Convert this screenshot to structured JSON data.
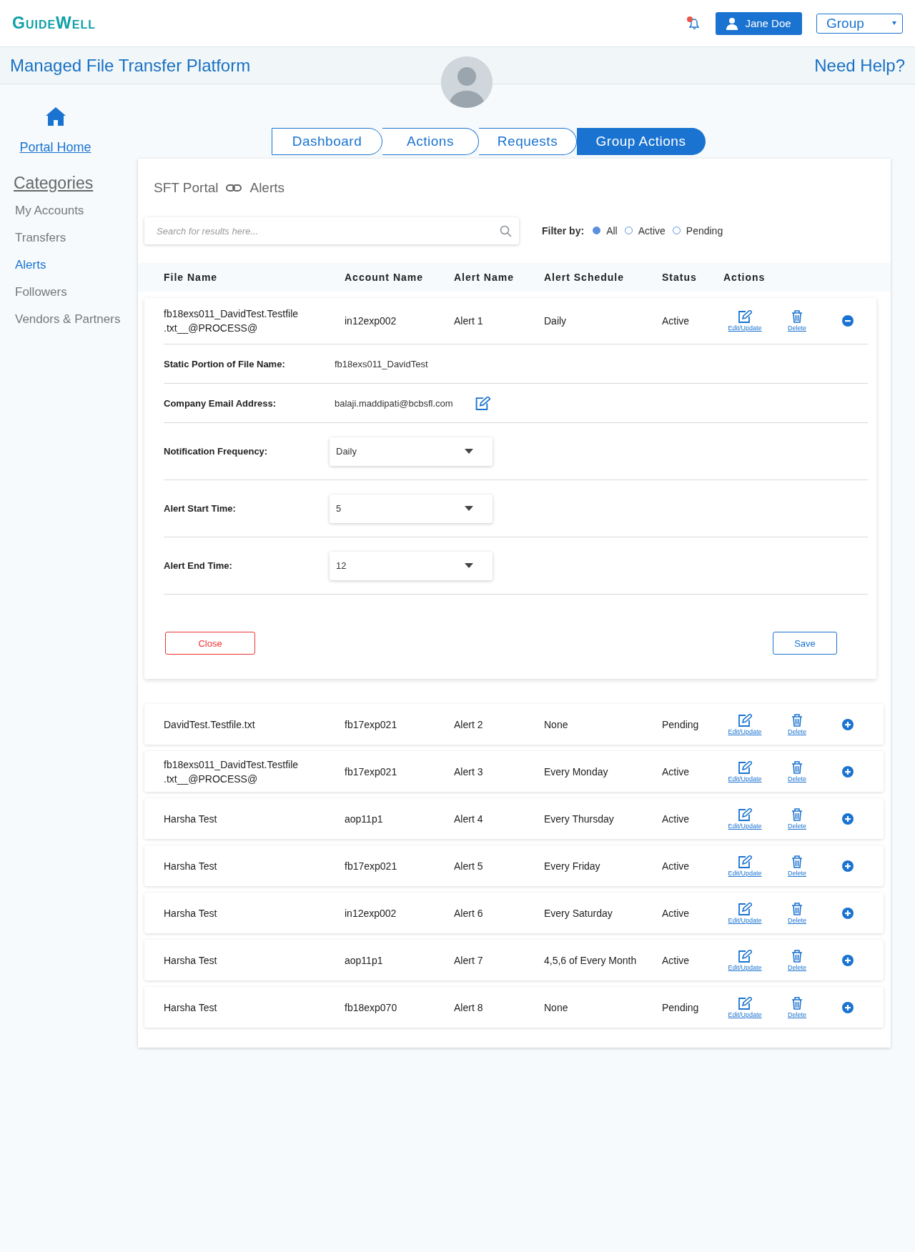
{
  "header": {
    "logo": "GuideWell",
    "user_button": "Jane Doe",
    "group_select": "Group"
  },
  "title_bar": {
    "title": "Managed File Transfer Platform",
    "help_link": "Need Help?"
  },
  "nav_tabs": [
    {
      "label": "Dashboard",
      "selected": false
    },
    {
      "label": "Actions",
      "selected": false
    },
    {
      "label": "Requests",
      "selected": false
    },
    {
      "label": "Group Actions",
      "selected": true
    }
  ],
  "sidebar": {
    "home_link": "Portal Home",
    "heading": "Categories",
    "items": [
      {
        "label": "My Accounts",
        "selected": false
      },
      {
        "label": "Transfers",
        "selected": false
      },
      {
        "label": "Alerts",
        "selected": true
      },
      {
        "label": "Followers",
        "selected": false
      },
      {
        "label": "Vendors & Partners",
        "selected": false
      }
    ]
  },
  "breadcrumb": [
    "SFT Portal",
    "Alerts"
  ],
  "search": {
    "placeholder": "Search for results here..."
  },
  "filter": {
    "label": "Filter by:",
    "options": [
      {
        "label": "All",
        "selected": true
      },
      {
        "label": "Active",
        "selected": false
      },
      {
        "label": "Pending",
        "selected": false
      }
    ]
  },
  "table": {
    "columns": [
      "File Name",
      "Account Name",
      "Alert Name",
      "Alert Schedule",
      "Status",
      "Actions"
    ],
    "rows": [
      {
        "file_name": "fb18exs011_DavidTest.Testfile\n.txt__@PROCESS@",
        "account_name": "in12exp002",
        "alert_name": "Alert 1",
        "schedule": "Daily",
        "status": "Active",
        "edit": "Edit/Update",
        "delete": "Delete",
        "expanded": true,
        "details": {
          "static_label": "Static Portion of File Name:",
          "static_value": "fb18exs011_DavidTest",
          "email_label": "Company Email Address:",
          "email_value": "balaji.maddipati@bcbsfl.com",
          "fields": [
            {
              "label": "Notification Frequency:",
              "value": "Daily"
            },
            {
              "label": "Alert Start Time:",
              "value": "5"
            },
            {
              "label": "Alert End Time:",
              "value": "12"
            }
          ],
          "close_button": "Close",
          "save_button": "Save"
        }
      },
      {
        "file_name": "DavidTest.Testfile.txt",
        "account_name": "fb17exp021",
        "alert_name": "Alert 2",
        "schedule": "None",
        "status": "Pending",
        "edit": "Edit/Update",
        "delete": "Delete",
        "expanded": false
      },
      {
        "file_name": "fb18exs011_DavidTest.Testfile\n.txt__@PROCESS@",
        "account_name": "fb17exp021",
        "alert_name": "Alert 3",
        "schedule": "Every Monday",
        "status": "Active",
        "edit": "Edit/Update",
        "delete": "Delete",
        "expanded": false
      },
      {
        "file_name": "Harsha Test",
        "account_name": "aop11p1",
        "alert_name": "Alert 4",
        "schedule": "Every Thursday",
        "status": "Active",
        "edit": "Edit/Update",
        "delete": "Delete",
        "expanded": false
      },
      {
        "file_name": "Harsha Test",
        "account_name": "fb17exp021",
        "alert_name": "Alert 5",
        "schedule": "Every Friday",
        "status": "Active",
        "edit": "Edit/Update",
        "delete": "Delete",
        "expanded": false
      },
      {
        "file_name": "Harsha Test",
        "account_name": "in12exp002",
        "alert_name": "Alert 6",
        "schedule": "Every Saturday",
        "status": "Active",
        "edit": "Edit/Update",
        "delete": "Delete",
        "expanded": false
      },
      {
        "file_name": "Harsha Test",
        "account_name": "aop11p1",
        "alert_name": "Alert 7",
        "schedule": "4,5,6 of Every Month",
        "status": "Active",
        "edit": "Edit/Update",
        "delete": "Delete",
        "expanded": false
      },
      {
        "file_name": "Harsha Test",
        "account_name": "fb18exp070",
        "alert_name": "Alert 8",
        "schedule": "None",
        "status": "Pending",
        "edit": "Edit/Update",
        "delete": "Delete",
        "expanded": false
      }
    ]
  }
}
